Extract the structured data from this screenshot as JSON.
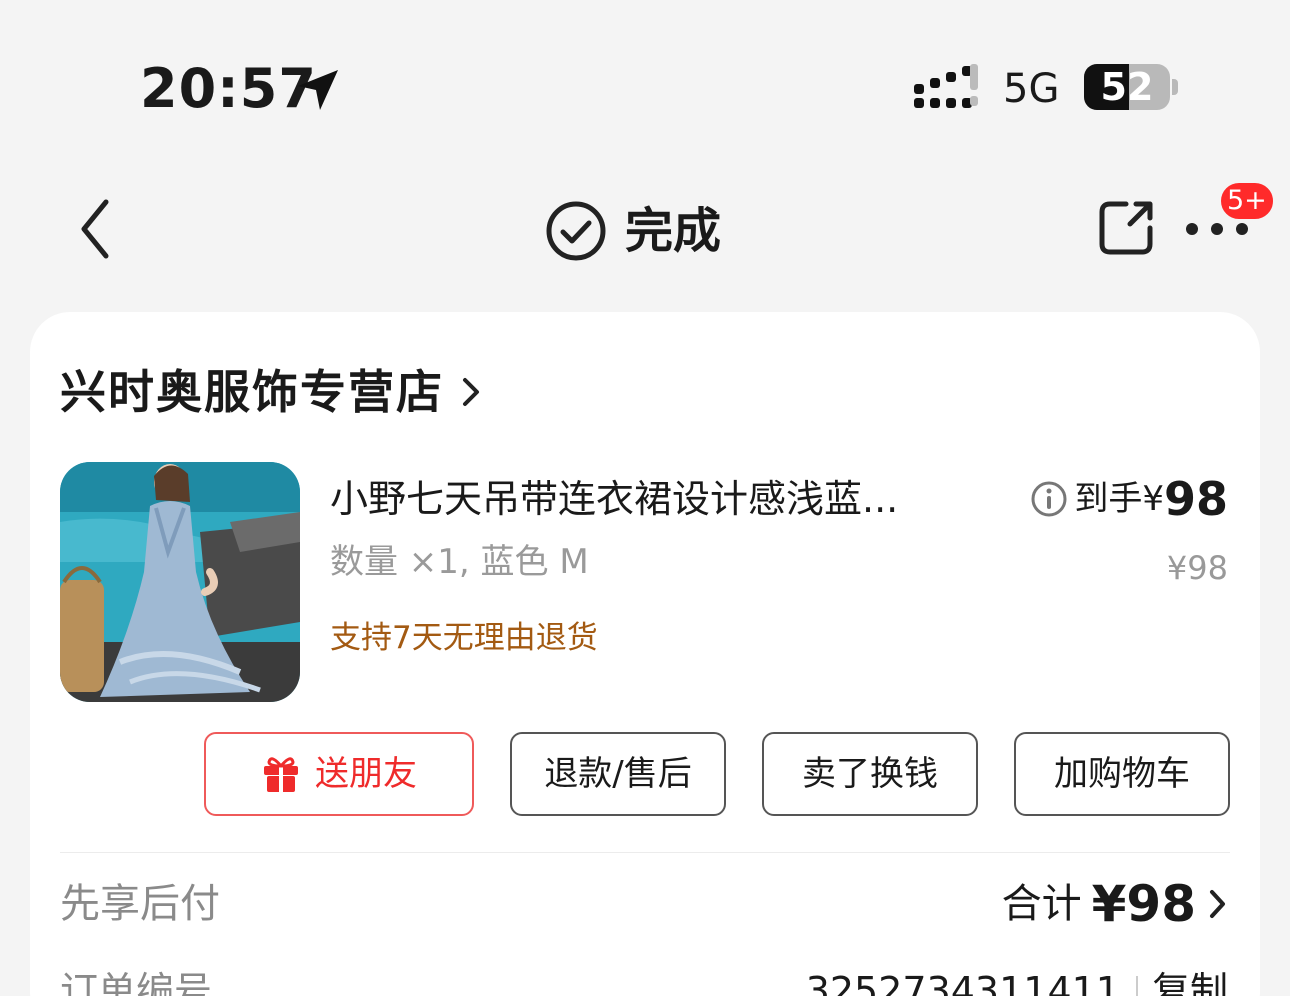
{
  "status_bar": {
    "time": "20:57",
    "network": "5G",
    "battery": "52",
    "battery_level_percent": 52
  },
  "nav": {
    "title": "完成",
    "badge": "5+"
  },
  "store": {
    "name": "兴时奥服饰专营店"
  },
  "product": {
    "title": "小野七天吊带连衣裙设计感浅蓝...",
    "spec": "数量 ×1, 蓝色 M",
    "return_policy": "支持7天无理由退货",
    "price_prefix": "到手¥",
    "price_value": "98",
    "original_price": "¥98"
  },
  "actions": {
    "gift": "送朋友",
    "refund": "退款/售后",
    "sell": "卖了换钱",
    "cart": "加购物车"
  },
  "summary": {
    "pay_later": "先享后付",
    "total_label": "合计",
    "total_value": "¥98"
  },
  "order": {
    "label": "订单编号",
    "number": "3252734311411",
    "copy": "复制"
  },
  "colors": {
    "accent_red": "#ef2b2b",
    "return_text": "#a35a12",
    "badge_red": "#ff2a2a"
  }
}
